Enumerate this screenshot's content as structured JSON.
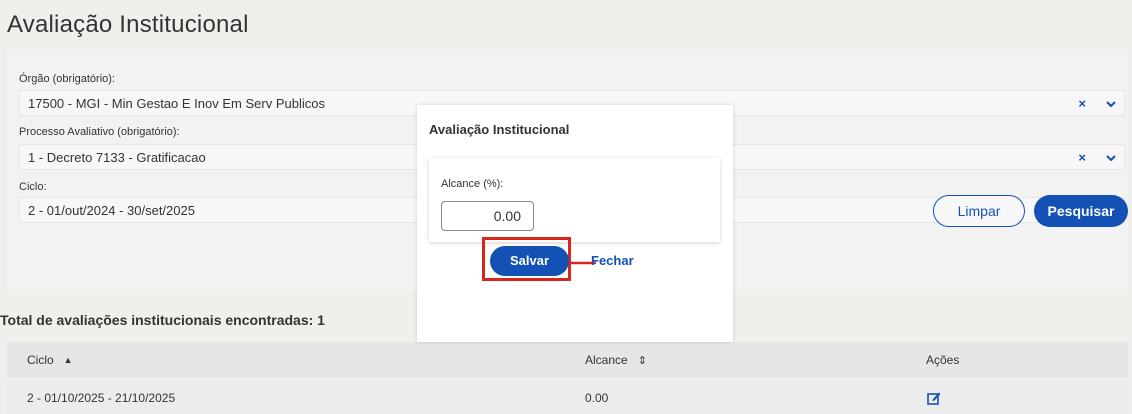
{
  "page": {
    "title": "Avaliação Institucional"
  },
  "filters": {
    "orgao": {
      "label": "Órgão (obrigatório):",
      "value": "17500 - MGI - Min Gestao E Inov Em Serv Publicos"
    },
    "processo": {
      "label": "Processo Avaliativo (obrigatório):",
      "value": "1 - Decreto 7133 - Gratificacao"
    },
    "ciclo": {
      "label": "Ciclo:",
      "value": "2 - 01/out/2024 - 30/set/2025"
    },
    "clear_glyph": "×",
    "chevron_glyph": "⌄",
    "limpar_label": "Limpar",
    "pesquisar_label": "Pesquisar"
  },
  "results": {
    "total_text": "Total de avaliações institucionais encontradas: 1",
    "columns": [
      {
        "label": "Ciclo",
        "sort_icon": "▲"
      },
      {
        "label": "Alcance",
        "sort_icon": "⇕"
      },
      {
        "label": "Ações"
      }
    ],
    "rows": [
      {
        "ciclo": "2 - 01/10/2025 - 21/10/2025",
        "alcance": "0.00",
        "action_icon": "edit-icon"
      }
    ]
  },
  "modal": {
    "title": "Avaliação Institucional",
    "field_label": "Alcance (%):",
    "field_value": "0.00",
    "save_label": "Salvar",
    "close_label": "Fechar"
  },
  "colors": {
    "primary": "#1351b4",
    "annotation": "#d9261c",
    "background": "#f0efec"
  }
}
